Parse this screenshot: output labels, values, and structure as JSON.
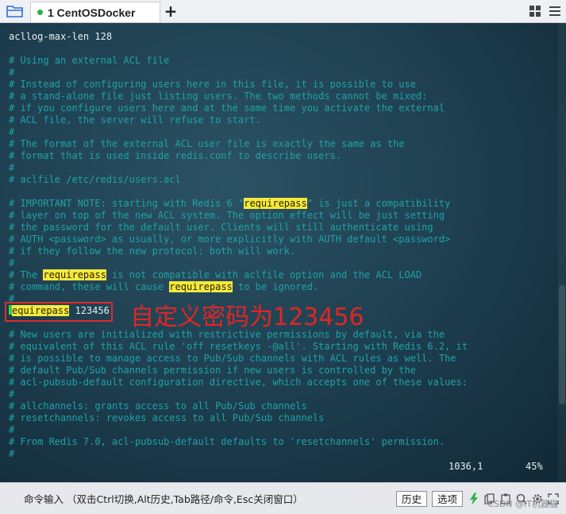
{
  "tabbar": {
    "tab_title": "1 CentOSDocker",
    "add_label": "+"
  },
  "terminal": {
    "lines": [
      {
        "segments": [
          {
            "t": "acllog-max-len 128",
            "s": "w"
          }
        ]
      },
      {
        "segments": [
          {
            "t": "",
            "s": "w"
          }
        ]
      },
      {
        "segments": [
          {
            "t": "# Using an external ACL file",
            "s": "c"
          }
        ]
      },
      {
        "segments": [
          {
            "t": "#",
            "s": "c"
          }
        ]
      },
      {
        "segments": [
          {
            "t": "# Instead of configuring users here in this file, it is possible to use",
            "s": "c"
          }
        ]
      },
      {
        "segments": [
          {
            "t": "# a stand-alone file just listing users. The two methods cannot be mixed:",
            "s": "c"
          }
        ]
      },
      {
        "segments": [
          {
            "t": "# if you configure users here and at the same time you activate the external",
            "s": "c"
          }
        ]
      },
      {
        "segments": [
          {
            "t": "# ACL file, the server will refuse to start.",
            "s": "c"
          }
        ]
      },
      {
        "segments": [
          {
            "t": "#",
            "s": "c"
          }
        ]
      },
      {
        "segments": [
          {
            "t": "# The format of the external ACL user file is exactly the same as the",
            "s": "c"
          }
        ]
      },
      {
        "segments": [
          {
            "t": "# format that is used inside redis.conf to describe users.",
            "s": "c"
          }
        ]
      },
      {
        "segments": [
          {
            "t": "#",
            "s": "c"
          }
        ]
      },
      {
        "segments": [
          {
            "t": "# aclfile /etc/redis/users.acl",
            "s": "c"
          }
        ]
      },
      {
        "segments": [
          {
            "t": "",
            "s": "w"
          }
        ]
      },
      {
        "segments": [
          {
            "t": "# IMPORTANT NOTE: starting with Redis 6 \"",
            "s": "c"
          },
          {
            "t": "requirepass",
            "s": "hl"
          },
          {
            "t": "\" is just a compatibility",
            "s": "c"
          }
        ]
      },
      {
        "segments": [
          {
            "t": "# layer on top of the new ACL system. The option effect will be just setting",
            "s": "c"
          }
        ]
      },
      {
        "segments": [
          {
            "t": "# the password for the default user. Clients will still authenticate using",
            "s": "c"
          }
        ]
      },
      {
        "segments": [
          {
            "t": "# AUTH <password> as usually, or more explicitly with AUTH default <password>",
            "s": "c"
          }
        ]
      },
      {
        "segments": [
          {
            "t": "# if they follow the new protocol: both will work.",
            "s": "c"
          }
        ]
      },
      {
        "segments": [
          {
            "t": "#",
            "s": "c"
          }
        ]
      },
      {
        "segments": [
          {
            "t": "# The ",
            "s": "c"
          },
          {
            "t": "requirepass",
            "s": "hl"
          },
          {
            "t": " is not compatible with aclfile option and the ACL LOAD",
            "s": "c"
          }
        ]
      },
      {
        "segments": [
          {
            "t": "# command, these will cause ",
            "s": "c"
          },
          {
            "t": "requirepass",
            "s": "hl"
          },
          {
            "t": " to be ignored.",
            "s": "c"
          }
        ]
      },
      {
        "segments": [
          {
            "t": "#",
            "s": "c"
          }
        ]
      },
      {
        "cursor": true,
        "segments": [
          {
            "t": "equirepass",
            "s": "hl"
          },
          {
            "t": " 123456",
            "s": "w"
          }
        ]
      },
      {
        "segments": [
          {
            "t": "",
            "s": "w"
          }
        ]
      },
      {
        "segments": [
          {
            "t": "# New users are initialized with restrictive permissions by default, via the",
            "s": "c"
          }
        ]
      },
      {
        "segments": [
          {
            "t": "# equivalent of this ACL rule 'off resetkeys -@all'. Starting with Redis 6.2, it",
            "s": "c"
          }
        ]
      },
      {
        "segments": [
          {
            "t": "# is possible to manage access to Pub/Sub channels with ACL rules as well. The",
            "s": "c"
          }
        ]
      },
      {
        "segments": [
          {
            "t": "# default Pub/Sub channels permission if new users is controlled by the",
            "s": "c"
          }
        ]
      },
      {
        "segments": [
          {
            "t": "# acl-pubsub-default configuration directive, which accepts one of these values:",
            "s": "c"
          }
        ]
      },
      {
        "segments": [
          {
            "t": "#",
            "s": "c"
          }
        ]
      },
      {
        "segments": [
          {
            "t": "# allchannels: grants access to all Pub/Sub channels",
            "s": "c"
          }
        ]
      },
      {
        "segments": [
          {
            "t": "# resetchannels: revokes access to all Pub/Sub channels",
            "s": "c"
          }
        ]
      },
      {
        "segments": [
          {
            "t": "#",
            "s": "c"
          }
        ]
      },
      {
        "segments": [
          {
            "t": "# From Redis 7.0, acl-pubsub-default defaults to 'resetchannels' permission.",
            "s": "c"
          }
        ]
      },
      {
        "segments": [
          {
            "t": "#",
            "s": "c"
          }
        ]
      }
    ],
    "annotation": "自定义密码为123456",
    "status_position": "1036,1",
    "status_percent": "45%"
  },
  "cmdbar": {
    "hint": "命令输入 （双击Ctrl切换,Alt历史,Tab路径/命令,Esc关闭窗口）",
    "history_label": "历史",
    "options_label": "选项",
    "watermark": "CSDN @IT机器猫"
  },
  "colors": {
    "comment": "#1fa3a6",
    "text": "#e7eef0",
    "highlight": "#f5e93c",
    "annotation": "#e32525",
    "cursor": "#31d24b"
  }
}
